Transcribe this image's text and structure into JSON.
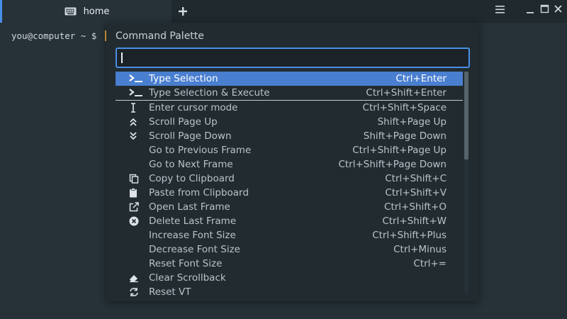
{
  "tabs": [
    {
      "label": "home",
      "icon": "keyboard-icon",
      "active": true
    }
  ],
  "window": {
    "new_tab_icon": "plus-icon",
    "menu_icon": "hamburger-menu-icon",
    "minimize_icon": "minimize-icon",
    "maximize_icon": "maximize-icon",
    "close_icon": "close-icon"
  },
  "terminal": {
    "prompt": "you@computer ~ $"
  },
  "palette": {
    "title": "Command Palette",
    "input_value": "",
    "accent_color": "#4a8fe7",
    "selected_color": "#4a7fd0",
    "items": [
      {
        "label": "Type Selection",
        "shortcut": "Ctrl+Enter",
        "icon": "terminal-prompt-icon",
        "selected": true
      },
      {
        "label": "Type Selection & Execute",
        "shortcut": "Ctrl+Shift+Enter",
        "icon": "terminal-prompt-icon"
      },
      {
        "label": "Enter cursor mode",
        "shortcut": "Ctrl+Shift+Space",
        "icon": "text-cursor-icon"
      },
      {
        "label": "Scroll Page Up",
        "shortcut": "Shift+Page Up",
        "icon": "chevrons-up-icon"
      },
      {
        "label": "Scroll Page Down",
        "shortcut": "Shift+Page Down",
        "icon": "chevrons-down-icon"
      },
      {
        "label": "Go to Previous Frame",
        "shortcut": "Ctrl+Shift+Page Up",
        "icon": ""
      },
      {
        "label": "Go to Next Frame",
        "shortcut": "Ctrl+Shift+Page Down",
        "icon": ""
      },
      {
        "label": "Copy to Clipboard",
        "shortcut": "Ctrl+Shift+C",
        "icon": "copy-icon"
      },
      {
        "label": "Paste from Clipboard",
        "shortcut": "Ctrl+Shift+V",
        "icon": "clipboard-icon"
      },
      {
        "label": "Open Last Frame",
        "shortcut": "Ctrl+Shift+O",
        "icon": "external-link-icon"
      },
      {
        "label": "Delete Last Frame",
        "shortcut": "Ctrl+Shift+W",
        "icon": "close-circle-icon"
      },
      {
        "label": "Increase Font Size",
        "shortcut": "Ctrl+Shift+Plus",
        "icon": ""
      },
      {
        "label": "Decrease Font Size",
        "shortcut": "Ctrl+Minus",
        "icon": ""
      },
      {
        "label": "Reset Font Size",
        "shortcut": "Ctrl+=",
        "icon": ""
      },
      {
        "label": "Clear Scrollback",
        "shortcut": "",
        "icon": "eraser-icon"
      },
      {
        "label": "Reset VT",
        "shortcut": "",
        "icon": "refresh-icon"
      }
    ]
  }
}
